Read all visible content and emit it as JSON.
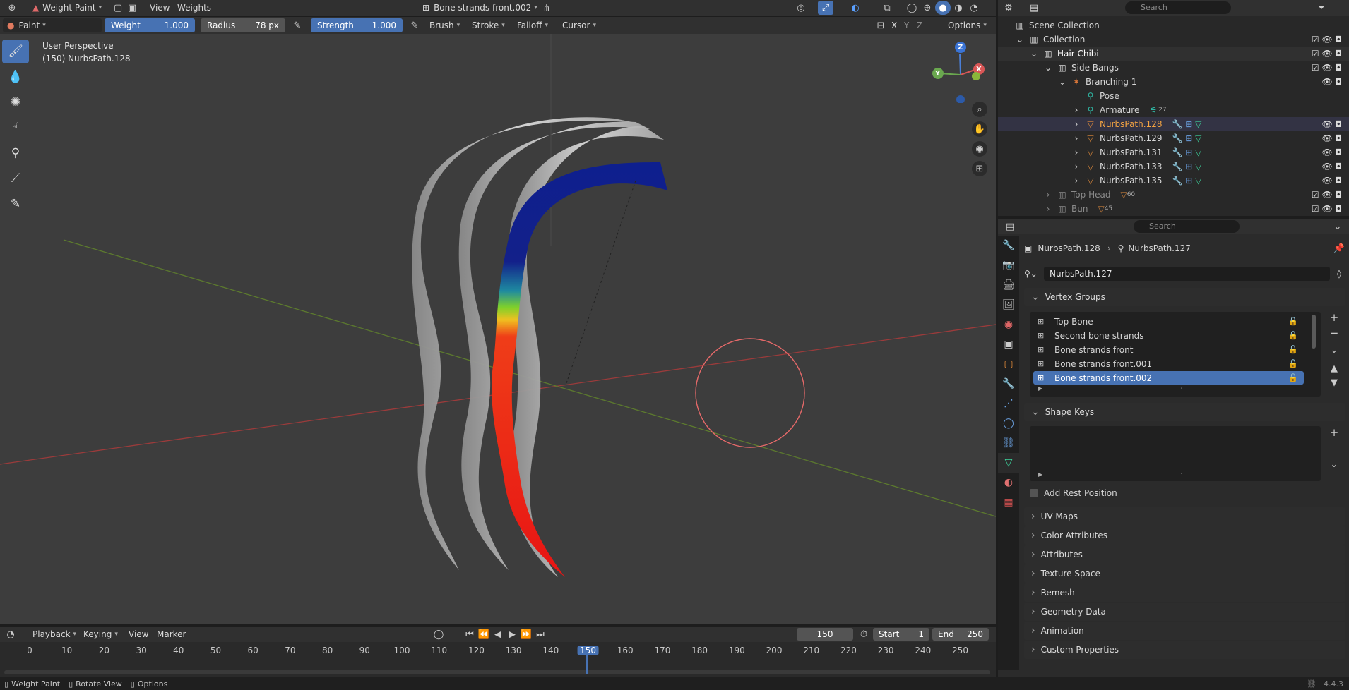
{
  "topbar": {
    "mode": "Weight Paint",
    "menus": [
      "View",
      "Weights"
    ],
    "active_group": "Bone strands front.002"
  },
  "tool_header": {
    "brush_name": "Paint",
    "weight_label": "Weight",
    "weight_value": "1.000",
    "radius_label": "Radius",
    "radius_value": "78 px",
    "strength_label": "Strength",
    "strength_value": "1.000",
    "menus": [
      "Brush",
      "Stroke",
      "Falloff",
      "Cursor"
    ],
    "axes": [
      "X",
      "Y",
      "Z"
    ],
    "options_label": "Options"
  },
  "viewport": {
    "perspective_label": "User Perspective",
    "object_label": "(150) NurbsPath.128",
    "gizmo_axes": [
      "Z",
      "Y",
      "X"
    ]
  },
  "outliner": {
    "search_placeholder": "Search",
    "items": [
      {
        "label": "Scene Collection"
      },
      {
        "label": "Collection"
      },
      {
        "label": "Hair Chibi"
      },
      {
        "label": "Side Bangs"
      },
      {
        "label": "Branching 1"
      },
      {
        "label": "Pose"
      },
      {
        "label": "Armature",
        "badge": "27"
      },
      {
        "label": "NurbsPath.128"
      },
      {
        "label": "NurbsPath.129"
      },
      {
        "label": "NurbsPath.131"
      },
      {
        "label": "NurbsPath.133"
      },
      {
        "label": "NurbsPath.135"
      },
      {
        "label": "Top Head",
        "badge": "60"
      },
      {
        "label": "Bun",
        "badge": "45"
      }
    ]
  },
  "properties": {
    "search_placeholder": "Search",
    "breadcrumb_object": "NurbsPath.128",
    "breadcrumb_data": "NurbsPath.127",
    "data_name": "NurbsPath.127",
    "vertex_groups_title": "Vertex Groups",
    "vertex_groups": [
      "Top Bone",
      "Second bone strands",
      "Bone strands front",
      "Bone strands front.001",
      "Bone strands front.002"
    ],
    "selected_group": "Bone strands front.002",
    "shape_keys_title": "Shape Keys",
    "add_rest_position": "Add Rest Position",
    "panels": [
      "UV Maps",
      "Color Attributes",
      "Attributes",
      "Texture Space",
      "Remesh",
      "Geometry Data",
      "Animation",
      "Custom Properties"
    ]
  },
  "timeline": {
    "menus": [
      "Playback",
      "Keying",
      "View",
      "Marker"
    ],
    "current_frame": "150",
    "start_label": "Start",
    "start_value": "1",
    "end_label": "End",
    "end_value": "250",
    "ticks": [
      "0",
      "10",
      "20",
      "30",
      "40",
      "50",
      "60",
      "70",
      "80",
      "90",
      "100",
      "110",
      "120",
      "130",
      "140",
      "150",
      "160",
      "170",
      "180",
      "190",
      "200",
      "210",
      "220",
      "230",
      "240",
      "250"
    ]
  },
  "statusbar": {
    "items": [
      "Weight Paint",
      "Rotate View",
      "Options"
    ],
    "version": "4.4.3"
  }
}
